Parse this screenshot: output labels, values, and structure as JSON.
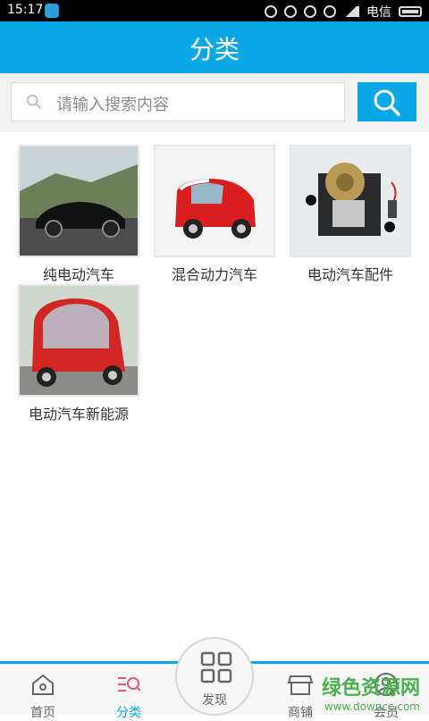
{
  "status_bar": {
    "time": "15:17",
    "carrier": "电信"
  },
  "header": {
    "title": "分类"
  },
  "search": {
    "placeholder": "请输入搜索内容"
  },
  "categories": [
    {
      "label": "纯电动汽车"
    },
    {
      "label": "混合动力汽车"
    },
    {
      "label": "电动汽车配件"
    },
    {
      "label": "电动汽车新能源"
    }
  ],
  "bottom_nav": [
    {
      "label": "首页",
      "icon": "home-icon"
    },
    {
      "label": "分类",
      "icon": "category-icon",
      "active": true
    },
    {
      "label": "发现",
      "icon": "grid-icon"
    },
    {
      "label": "商铺",
      "icon": "shop-icon"
    },
    {
      "label": "会员",
      "icon": "user-icon"
    }
  ],
  "watermark": {
    "line1": "绿色资源网",
    "line2": "www.downcc.com"
  },
  "colors": {
    "accent": "#0aa7e5"
  }
}
